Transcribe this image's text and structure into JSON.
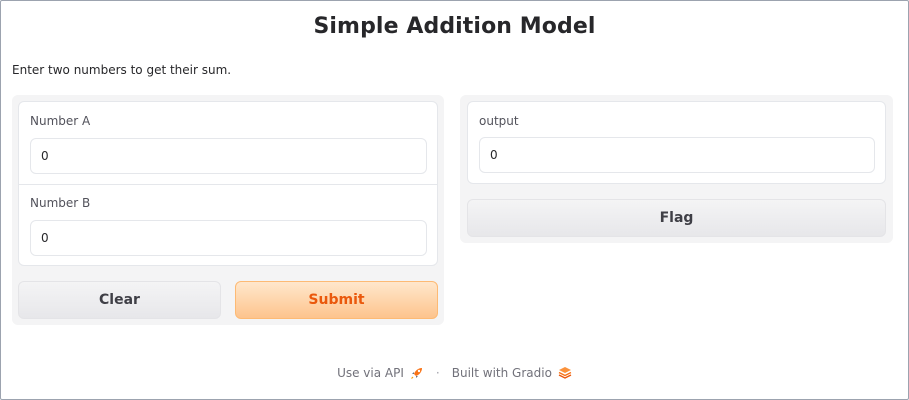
{
  "app": {
    "title": "Simple Addition Model",
    "description": "Enter two numbers to get their sum."
  },
  "inputs": {
    "number_a": {
      "label": "Number A",
      "value": "0"
    },
    "number_b": {
      "label": "Number B",
      "value": "0"
    }
  },
  "output": {
    "label": "output",
    "value": "0"
  },
  "buttons": {
    "clear": "Clear",
    "submit": "Submit",
    "flag": "Flag"
  },
  "footer": {
    "api_link": "Use via API",
    "separator": "·",
    "built_with": "Built with Gradio",
    "api_icon": "rocket-icon",
    "gradio_icon": "gradio-logo-icon"
  },
  "colors": {
    "primary_text": "#ea580c",
    "primary_bg": "#fdc48d",
    "panel_bg": "#f4f4f5"
  }
}
